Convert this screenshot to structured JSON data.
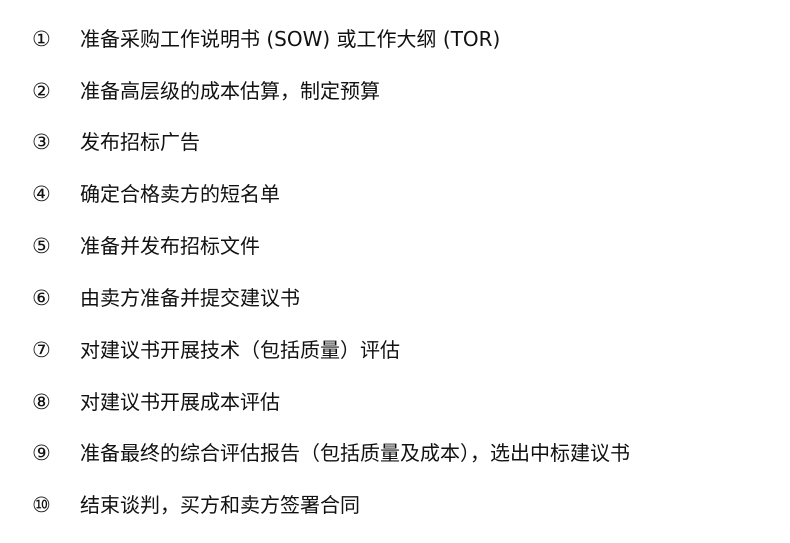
{
  "steps": [
    {
      "number": "①",
      "text": "准备采购工作说明书 (SOW) 或工作大纲 (TOR)"
    },
    {
      "number": "②",
      "text": "准备高层级的成本估算，制定预算"
    },
    {
      "number": "③",
      "text": "发布招标广告"
    },
    {
      "number": "④",
      "text": "确定合格卖方的短名单"
    },
    {
      "number": "⑤",
      "text": "准备并发布招标文件"
    },
    {
      "number": "⑥",
      "text": "由卖方准备并提交建议书"
    },
    {
      "number": "⑦",
      "text": "对建议书开展技术（包括质量）评估"
    },
    {
      "number": "⑧",
      "text": "对建议书开展成本评估"
    },
    {
      "number": "⑨",
      "text": "准备最终的综合评估报告（包括质量及成本），选出中标建议书"
    },
    {
      "number": "⑩",
      "text": "结束谈判，买方和卖方签署合同"
    }
  ]
}
